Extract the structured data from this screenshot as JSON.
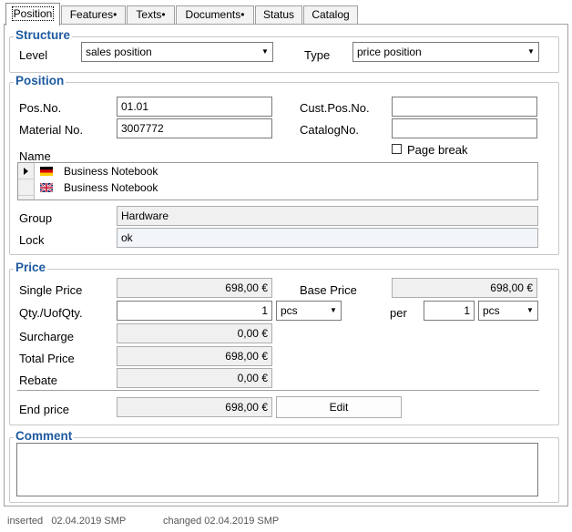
{
  "tabs": [
    {
      "label": "Position",
      "active": true
    },
    {
      "label": "Features•",
      "active": false
    },
    {
      "label": "Texts•",
      "active": false
    },
    {
      "label": "Documents•",
      "active": false
    },
    {
      "label": "Status",
      "active": false
    },
    {
      "label": "Catalog",
      "active": false
    }
  ],
  "structure": {
    "legend": "Structure",
    "level_label": "Level",
    "level_value": "sales position",
    "type_label": "Type",
    "type_value": "price position"
  },
  "position": {
    "legend": "Position",
    "pos_no_label": "Pos.No.",
    "pos_no_value": "01.01",
    "material_no_label": "Material No.",
    "material_no_value": "3007772",
    "cust_pos_no_label": "Cust.Pos.No.",
    "cust_pos_no_value": "",
    "catalog_no_label": "CatalogNo.",
    "catalog_no_value": "",
    "page_break_label": "Page break",
    "page_break_checked": false,
    "name_label": "Name",
    "names": [
      {
        "flag": "de-flag-icon",
        "text": "Business Notebook"
      },
      {
        "flag": "gb-flag-icon",
        "text": "Business Notebook"
      }
    ],
    "group_label": "Group",
    "group_value": "Hardware",
    "lock_label": "Lock",
    "lock_value": "ok"
  },
  "price": {
    "legend": "Price",
    "single_price_label": "Single Price",
    "single_price_value": "698,00 €",
    "base_price_label": "Base Price",
    "base_price_value": "698,00 €",
    "qty_label": "Qty./UofQty.",
    "qty_value": "1",
    "qty_unit": "pcs",
    "per_label": "per",
    "per_value": "1",
    "per_unit": "pcs",
    "surcharge_label": "Surcharge",
    "surcharge_value": "0,00 €",
    "total_price_label": "Total Price",
    "total_price_value": "698,00 €",
    "rebate_label": "Rebate",
    "rebate_value": "0,00 €",
    "end_price_label": "End price",
    "end_price_value": "698,00 €",
    "edit_label": "Edit"
  },
  "comment": {
    "legend": "Comment",
    "value": ""
  },
  "footer": {
    "inserted_label": "inserted",
    "inserted_value": "02.04.2019  SMP",
    "changed_label": "changed",
    "changed_value": "02.04.2019  SMP"
  }
}
